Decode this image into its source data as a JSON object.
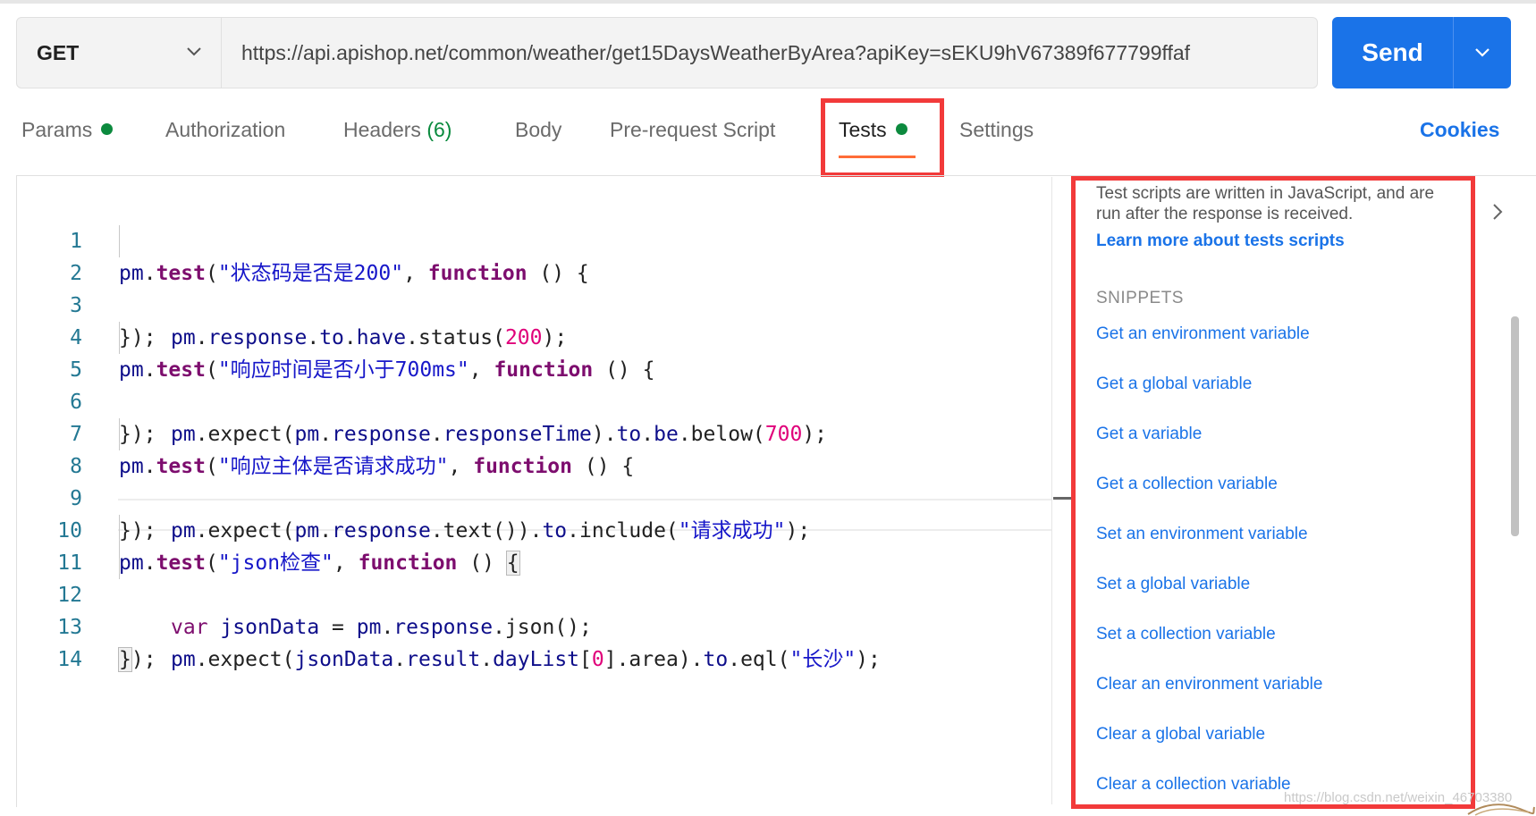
{
  "request": {
    "method": "GET",
    "url": "https://api.apishop.net/common/weather/get15DaysWeatherByArea?apiKey=sEKU9hV67389f677799ffaf",
    "send_label": "Send"
  },
  "tabs": {
    "params": "Params",
    "authorization": "Authorization",
    "headers": "Headers",
    "headers_count": "(6)",
    "body": "Body",
    "prerequest": "Pre-request Script",
    "tests": "Tests",
    "settings": "Settings",
    "cookies": "Cookies"
  },
  "editor": {
    "lines": [
      "1",
      "2",
      "3",
      "4",
      "5",
      "6",
      "7",
      "8",
      "9",
      "10",
      "11",
      "12",
      "13",
      "14"
    ],
    "t1": "\"状态码是否是200\"",
    "n200": "200",
    "t2": "\"响应时间是否小于700ms\"",
    "n700": "700",
    "t3": "\"响应主体是否请求成功\"",
    "s_success": "\"请求成功\"",
    "t4": "\"json检查\"",
    "n0": "0",
    "s_city": "\"长沙\""
  },
  "side_panel": {
    "description": "Test scripts are written in JavaScript, and are run after the response is received.",
    "learn_more": "Learn more about tests scripts",
    "snippets_heading": "SNIPPETS",
    "snippets": [
      "Get an environment variable",
      "Get a global variable",
      "Get a variable",
      "Get a collection variable",
      "Set an environment variable",
      "Set a global variable",
      "Set a collection variable",
      "Clear an environment variable",
      "Clear a global variable",
      "Clear a collection variable"
    ]
  },
  "watermark": "https://blog.csdn.net/weixin_46703380",
  "colors": {
    "accent": "#1a73e8",
    "tab_indicator": "#ff6c37",
    "status_dot": "#0c8a3e",
    "highlight_box": "#f23a3a"
  }
}
